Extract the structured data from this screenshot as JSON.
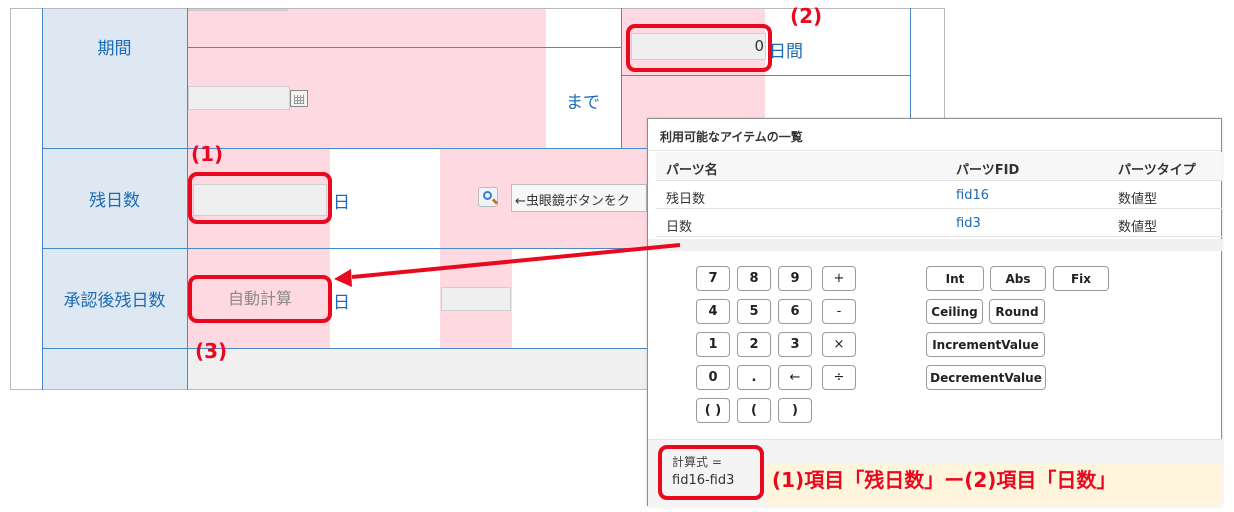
{
  "form": {
    "period_label": "期間",
    "until_label": "まで",
    "days_value": "0",
    "days_unit": "日間",
    "remaining_label": "残日数",
    "remaining_unit": "日",
    "lookup_hint": "←虫眼鏡ボタンをク",
    "after_label": "承認後残日数",
    "auto_calc_placeholder": "自動計算",
    "after_unit": "日"
  },
  "annotations": {
    "marker1": "(1)",
    "marker2": "(2)",
    "marker3": "(3)",
    "formula_note": "(1)項目「残日数」ー(2)項目「日数」"
  },
  "panel": {
    "title": "利用可能なアイテムの一覧",
    "headers": [
      "パーツ名",
      "パーツFID",
      "パーツタイプ"
    ],
    "rows": [
      {
        "name": "残日数",
        "fid": "fid16",
        "type": "数値型"
      },
      {
        "name": "日数",
        "fid": "fid3",
        "type": "数値型"
      }
    ],
    "keys": {
      "k7": "7",
      "k8": "8",
      "k9": "9",
      "plus": "+",
      "k4": "4",
      "k5": "5",
      "k6": "6",
      "minus": "-",
      "k1": "1",
      "k2": "2",
      "k3": "3",
      "times": "×",
      "k0": "0",
      "dot": ".",
      "back": "←",
      "divide": "÷",
      "parens": "( )",
      "lparen": "(",
      "rparen": ")"
    },
    "functions": {
      "int": "Int",
      "abs": "Abs",
      "fix": "Fix",
      "ceiling": "Ceiling",
      "round": "Round",
      "increment": "IncrementValue",
      "decrement": "DecrementValue"
    },
    "formula_label": "計算式 =",
    "formula_value": "fid16-fid3"
  },
  "colors": {
    "accent_red": "#e8091e",
    "label_blue": "#1c6bb5",
    "pink": "#ffd9e1",
    "label_bg": "#dde8f3"
  }
}
